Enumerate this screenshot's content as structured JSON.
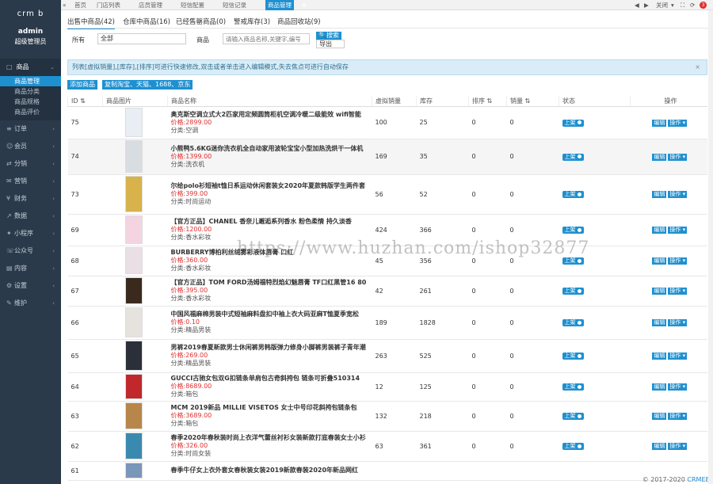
{
  "sidebar": {
    "logo": "crm  b",
    "admin": "admin",
    "role": "超级管理员",
    "top_item": "商品",
    "sub_items": [
      "商品管理",
      "商品分类",
      "商品规格",
      "商品评价"
    ],
    "items": [
      "订单",
      "会员",
      "分销",
      "营销",
      "财务",
      "数据",
      "小程序",
      "公众号",
      "内容",
      "设置",
      "维护"
    ]
  },
  "topbar": {
    "tabs": [
      "首页",
      "门店列表",
      "店员管理",
      "短信配置",
      "短信记录",
      "商品管理"
    ],
    "close_label": "关闭",
    "badge": "3"
  },
  "subtabs": [
    "出售中商品(42)",
    "仓库中商品(16)",
    "已经售罄商品(0)",
    "警戒库存(3)",
    "商品回收站(9)"
  ],
  "filter": {
    "label_all": "所有",
    "select_value": "全部",
    "label_goods": "商品",
    "search_placeholder": "请输入商品名称,关键字,编号",
    "search_btn": "搜索",
    "export_btn": "导出"
  },
  "notice": "列表[虚拟销量],[库存],[排序]可进行快速修改,双击或者单击进入编辑模式,失去焦点可进行自动保存",
  "actions": {
    "add": "添加商品",
    "copy": "复制淘宝、天猫、1688、京东"
  },
  "table": {
    "headers": [
      "ID",
      "商品图片",
      "商品名称",
      "虚拟销量",
      "库存",
      "排序",
      "销量",
      "状态",
      "操作"
    ],
    "toggle_label": "上架",
    "op_edit": "编辑",
    "op_more": "操作",
    "rows": [
      {
        "id": "75",
        "name": "奥克斯空调立式大2匹家用定频圆筒柜机空调冷暖二级能效 wifi智能",
        "price": "价格:2899.00",
        "cat": "分类:空调",
        "virtual": "100",
        "stock": "25",
        "sort": "0",
        "sales": "0",
        "pic": "#e8eef4"
      },
      {
        "id": "74",
        "name": "小熊鸭5.6KG迷你洗衣机全自动家用波轮宝宝小型加热洗烘干一体机",
        "price": "价格:1399.00",
        "cat": "分类:洗衣机",
        "virtual": "169",
        "stock": "35",
        "sort": "0",
        "sales": "0",
        "pic": "#d8dde2"
      },
      {
        "id": "73",
        "name": "尔给polo衫短袖t恤日系运动休闲套装女2020年夏款韩版学生两件套",
        "price": "价格:399.00",
        "cat": "分类:时尚运动",
        "virtual": "56",
        "stock": "52",
        "sort": "0",
        "sales": "0",
        "pic": "#d8b24a"
      },
      {
        "id": "69",
        "name": "【官方正品】CHANEL 香奈儿邂逅系列香水 粉色柔情 持久淡香",
        "price": "价格:1200.00",
        "cat": "分类:香水彩妆",
        "virtual": "424",
        "stock": "366",
        "sort": "0",
        "sales": "0",
        "pic": "#f3d4e0"
      },
      {
        "id": "68",
        "name": "BURBERRY博柏利丝绒雾彩液体唇膏 口红",
        "price": "价格:360.00",
        "cat": "分类:香水彩妆",
        "virtual": "45",
        "stock": "356",
        "sort": "0",
        "sales": "0",
        "pic": "#e9dfe4"
      },
      {
        "id": "67",
        "name": "【官方正品】TOM FORD汤姆福特烈焰幻魅唇膏 TF口红黑管16 80",
        "price": "价格:395.00",
        "cat": "分类:香水彩妆",
        "virtual": "42",
        "stock": "261",
        "sort": "0",
        "sales": "0",
        "pic": "#3a2a1e"
      },
      {
        "id": "66",
        "name": "中国风福麻棉男装中式短袖麻料盘扣中袖上衣大码亚麻T恤夏季宽松",
        "price": "价格:0.10",
        "cat": "分类:精品男装",
        "virtual": "189",
        "stock": "1828",
        "sort": "0",
        "sales": "0",
        "pic": "#e6e3de"
      },
      {
        "id": "65",
        "name": "男裤2019春夏新款男士休闲裤男韩版弹力修身小脚裤男装裤子青年潮",
        "price": "价格:269.00",
        "cat": "分类:精品男装",
        "virtual": "263",
        "stock": "525",
        "sort": "0",
        "sales": "0",
        "pic": "#2a2f3a"
      },
      {
        "id": "64",
        "name": "GUCCI古驰女包双G扣链条单肩包古奇斜挎包 链条可折叠510314",
        "price": "价格:8689.00",
        "cat": "分类:箱包",
        "virtual": "12",
        "stock": "125",
        "sort": "0",
        "sales": "0",
        "pic": "#c0282c"
      },
      {
        "id": "63",
        "name": "MCM 2019新品 MILLIE VISETOS 女士中号印花斜挎包链条包",
        "price": "价格:3689.00",
        "cat": "分类:箱包",
        "virtual": "132",
        "stock": "218",
        "sort": "0",
        "sales": "0",
        "pic": "#b8864a"
      },
      {
        "id": "62",
        "name": "春季2020年春秋装时尚上衣洋气蕾丝衬衫女装新款打底春装女士小衫",
        "price": "价格:326.00",
        "cat": "分类:时尚女装",
        "virtual": "63",
        "stock": "361",
        "sort": "0",
        "sales": "0",
        "pic": "#3a8ab0"
      },
      {
        "id": "61",
        "name": "春季牛仔女上衣外套女春秋装女装2019新款春装2020年新品网红",
        "price": "",
        "cat": "",
        "virtual": "",
        "stock": "",
        "sort": "",
        "sales": "",
        "pic": "#7a96b8"
      }
    ]
  },
  "watermark": "https://www.huzhan.com/ishop32877",
  "footer": {
    "copy": "© 2017-2020 ",
    "brand": "CRMEB"
  }
}
